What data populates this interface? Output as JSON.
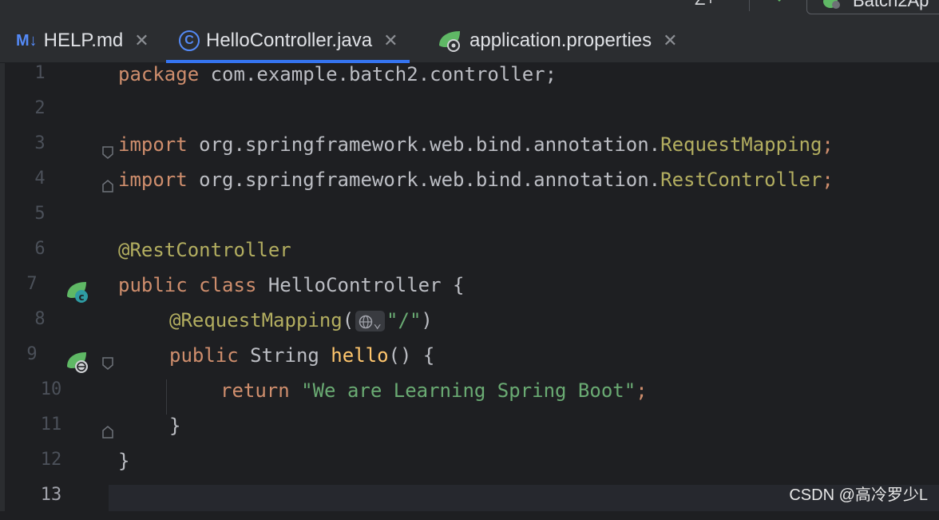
{
  "toolbar": {
    "add_label": "Z+",
    "run_config_label": "Batch2Ap",
    "icons": [
      "add-icon",
      "hammer-icon",
      "spring-boot-icon"
    ]
  },
  "tabs": [
    {
      "icon": "markdown-icon",
      "icon_text": "M↓",
      "label": "HELP.md",
      "close": "✕",
      "active": false
    },
    {
      "icon": "java-class-icon",
      "icon_text": "C",
      "label": "HelloController.java",
      "close": "✕",
      "active": true
    },
    {
      "icon": "spring-properties-icon",
      "icon_text": "",
      "label": "application.properties",
      "close": "✕",
      "active": false
    }
  ],
  "editor": {
    "line_numbers": [
      "1",
      "2",
      "3",
      "4",
      "5",
      "6",
      "7",
      "8",
      "9",
      "10",
      "11",
      "12",
      "13"
    ],
    "lines": {
      "l1_kw": "package",
      "l1_rest": " com.example.batch2.controller;",
      "l3_kw": "import",
      "l3_pkg": " org.springframework.web.bind.annotation.",
      "l3_cls": "RequestMapping",
      "l3_semi": ";",
      "l4_kw": "import",
      "l4_pkg": " org.springframework.web.bind.annotation.",
      "l4_cls": "RestController",
      "l4_semi": ";",
      "l6_ann": "@RestController",
      "l7_kw": "public class",
      "l7_rest": " HelloController {",
      "l8_ann": "@RequestMapping",
      "l8_open": "(",
      "l8_inlay": "⌄",
      "l8_str": "\"/\"",
      "l8_close": ")",
      "l9_kw": "public",
      "l9_type": " String ",
      "l9_fn": "hello",
      "l9_rest": "() {",
      "l10_kw": "return",
      "l10_str": " \"We are Learning Spring Boot\"",
      "l10_semi": ";",
      "l11": "}",
      "l12": "}"
    }
  },
  "watermark": "CSDN @高冷罗少L",
  "colors": {
    "keyword": "#cf8e6d",
    "annotation": "#b3ae60",
    "string": "#6aab73",
    "function": "#ffc66d",
    "accent": "#3574f0",
    "background": "#1e1f22"
  }
}
